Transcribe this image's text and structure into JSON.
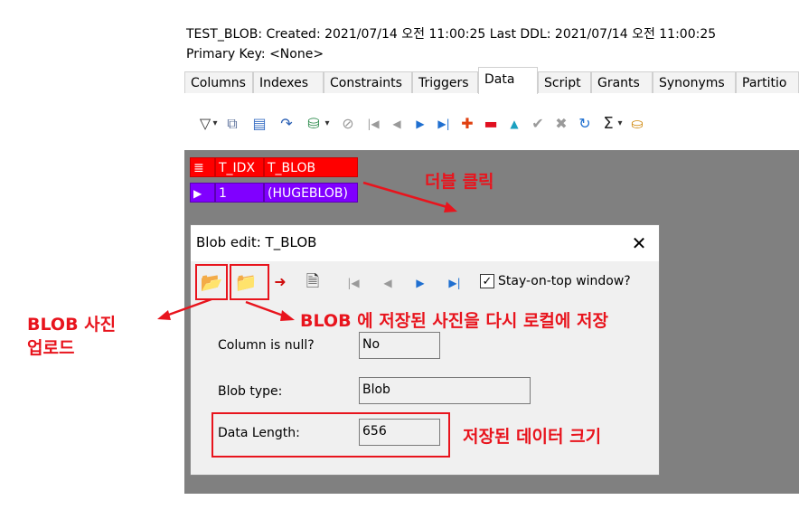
{
  "header": {
    "info_line": "TEST_BLOB:  Created: 2021/07/14 오전 11:00:25  Last DDL: 2021/07/14 오전 11:00:25",
    "primary_key": "Primary Key:  <None>"
  },
  "tabs": [
    {
      "label": "Columns"
    },
    {
      "label": "Indexes"
    },
    {
      "label": "Constraints"
    },
    {
      "label": "Triggers"
    },
    {
      "label": "Data",
      "active": true
    },
    {
      "label": "Script"
    },
    {
      "label": "Grants"
    },
    {
      "label": "Synonyms"
    },
    {
      "label": "Partitio"
    }
  ],
  "toolbar": {
    "icons": [
      "filter-icon",
      "copy-record-icon",
      "view-form-icon",
      "refresh-icon",
      "export-data-icon",
      "clear-icon",
      "first-record-icon",
      "prior-record-icon",
      "next-record-icon",
      "last-record-icon",
      "insert-record-icon",
      "delete-record-icon",
      "edit-record-icon",
      "post-edit-icon",
      "cancel-edit-icon",
      "refresh-data-icon",
      "sum-icon",
      "save-icon"
    ]
  },
  "grid": {
    "columns": [
      "T_IDX",
      "T_BLOB"
    ],
    "rows": [
      {
        "t_idx": "1",
        "t_blob": "(HUGEBLOB)"
      }
    ],
    "header_color": "#ff0000",
    "row_color": "#8000ff"
  },
  "dialog": {
    "title": "Blob edit: T_BLOB",
    "close_glyph": "✕",
    "stay_on_top_label": "Stay-on-top window?",
    "stay_on_top_checked": true,
    "fields": {
      "column_null_label": "Column is null?",
      "column_null_value": "No",
      "blob_type_label": "Blob type:",
      "blob_type_value": "Blob",
      "data_length_label": "Data Length:",
      "data_length_value": "656"
    }
  },
  "annotations": {
    "double_click": "더블 클릭",
    "upload_line1": "BLOB 사진",
    "upload_line2": "업로드",
    "save_local": "BLOB 에 저장된 사진을 다시 로컬에 저장",
    "data_size": "저장된 데이터 크기",
    "accent_color": "#e8141d"
  }
}
